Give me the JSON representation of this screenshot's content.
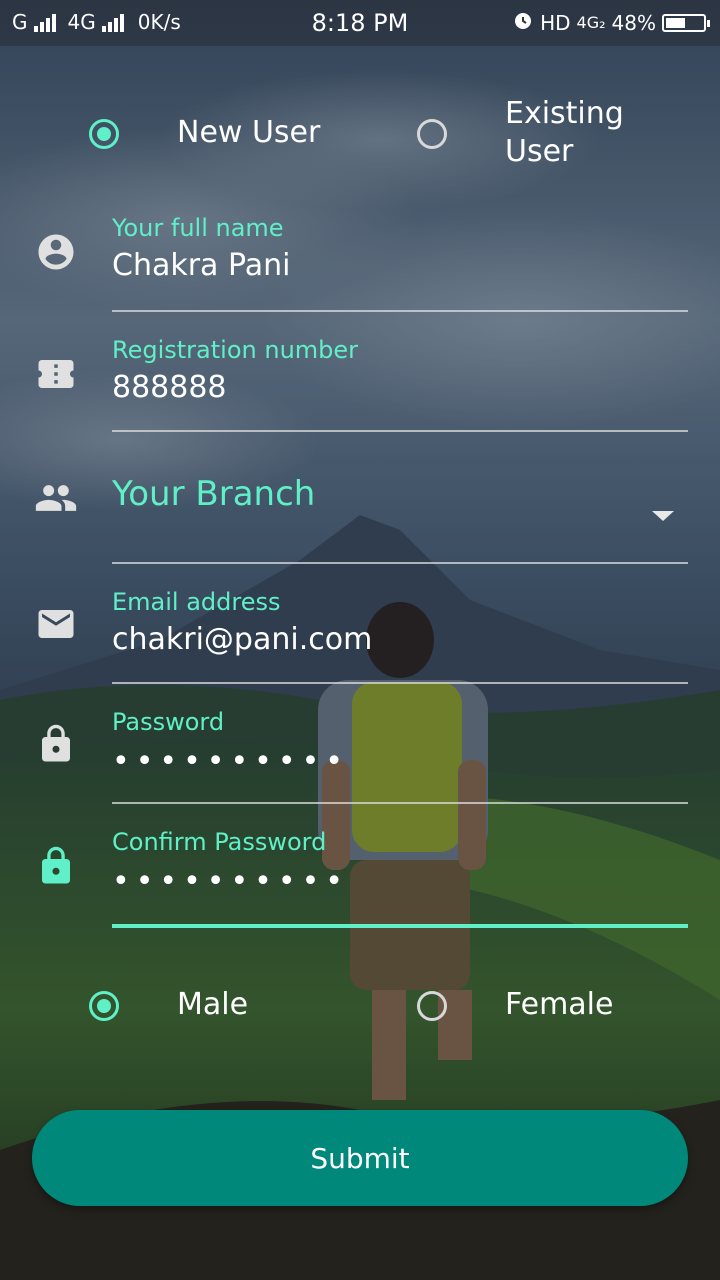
{
  "status_bar": {
    "carrier1": "G",
    "carrier2": "4G",
    "net_speed": "0K/s",
    "time": "8:18 PM",
    "hd": "HD",
    "network_type": "4G₂",
    "battery_percent": "48%",
    "battery_level": 0.48
  },
  "user_type": {
    "new_user_label": "New User",
    "existing_user_label": "Existing User",
    "selected": "New User"
  },
  "form": {
    "full_name": {
      "label": "Your full name",
      "value": "Chakra Pani"
    },
    "registration": {
      "label": "Registration number",
      "value": "888888"
    },
    "branch": {
      "placeholder": "Your Branch"
    },
    "email": {
      "label": "Email address",
      "value": "chakri@pani.com"
    },
    "password": {
      "label": "Password",
      "value": "••••••••••"
    },
    "confirm_password": {
      "label": "Confirm Password",
      "value": "••••••••••"
    }
  },
  "gender": {
    "male_label": "Male",
    "female_label": "Female",
    "selected": "Male"
  },
  "submit_label": "Submit",
  "colors": {
    "accent": "#5ff0c8",
    "button": "#00897b"
  }
}
